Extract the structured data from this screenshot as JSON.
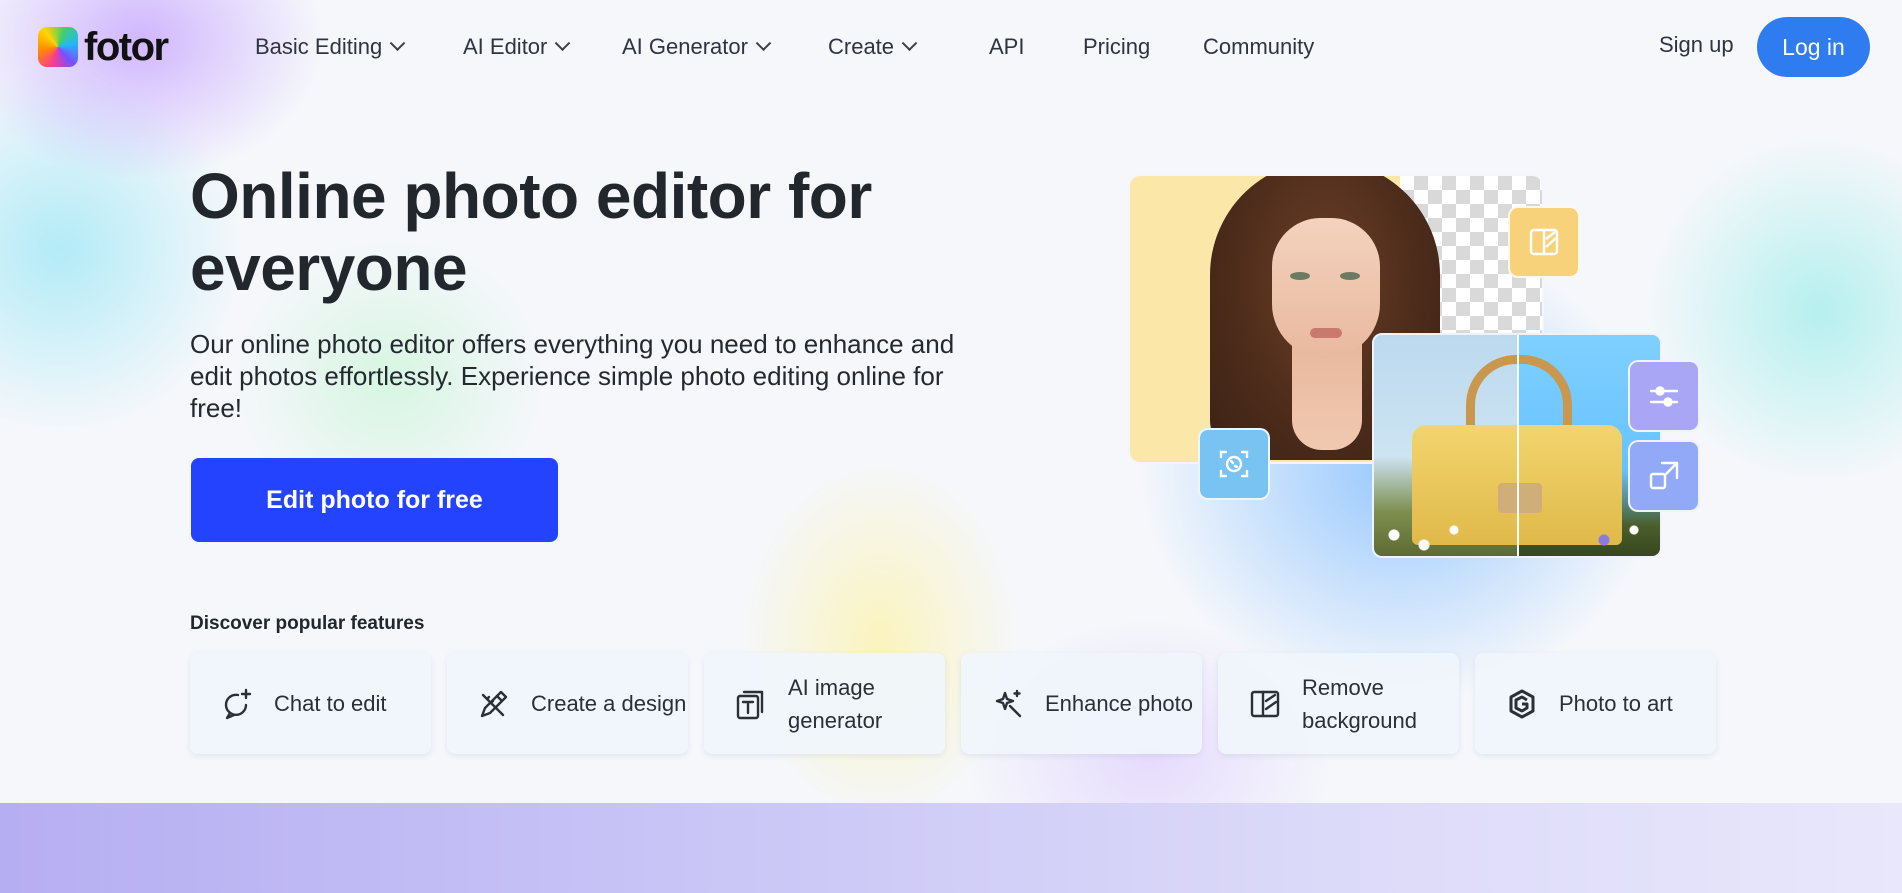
{
  "brand": {
    "logo_text": "fotor"
  },
  "nav": {
    "items": [
      {
        "label": "Basic Editing",
        "dropdown": true
      },
      {
        "label": "AI Editor",
        "dropdown": true
      },
      {
        "label": "AI Generator",
        "dropdown": true
      },
      {
        "label": "Create",
        "dropdown": true
      },
      {
        "label": "API",
        "dropdown": false
      },
      {
        "label": "Pricing",
        "dropdown": false
      },
      {
        "label": "Community",
        "dropdown": false
      }
    ],
    "signup_label": "Sign up",
    "login_label": "Log in"
  },
  "hero": {
    "title": "Online photo editor for everyone",
    "description": "Our online photo editor offers everything you need to enhance and edit photos effortlessly. Experience simple photo editing online for free!",
    "cta_label": "Edit photo for free"
  },
  "features": {
    "heading": "Discover popular features",
    "items": [
      {
        "label": "Chat to edit",
        "icon": "chat-sparkle-icon"
      },
      {
        "label": "Create a design",
        "icon": "pencil-ruler-icon"
      },
      {
        "label": "AI image generator",
        "icon": "ai-image-icon"
      },
      {
        "label": "Enhance photo",
        "icon": "magic-sparkle-icon"
      },
      {
        "label": "Remove background",
        "icon": "remove-bg-icon"
      },
      {
        "label": "Photo to art",
        "icon": "photo-art-icon"
      }
    ]
  },
  "illustration_tools": [
    {
      "icon": "remove-bg-icon",
      "color": "#f7d27a"
    },
    {
      "icon": "retouch-icon",
      "color": "#78c3f2"
    },
    {
      "icon": "adjust-sliders-icon",
      "color": "#a9a7f5"
    },
    {
      "icon": "resize-expand-icon",
      "color": "#92a9f7"
    }
  ],
  "colors": {
    "accent_blue": "#2f7cf0",
    "cta_blue": "#2343ff",
    "text_dark": "#22272e"
  }
}
